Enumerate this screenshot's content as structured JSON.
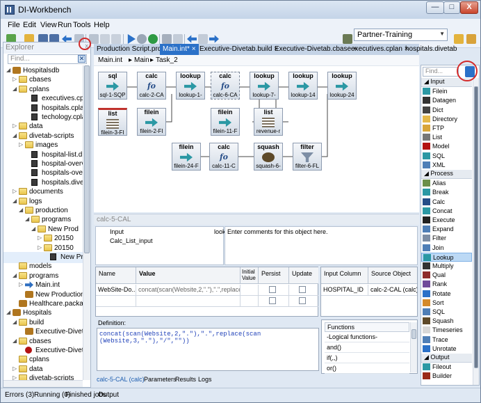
{
  "window": {
    "title": "DI-Workbench",
    "min": "—",
    "max": "□",
    "close": "X"
  },
  "menu": [
    "File",
    "Edit",
    "View",
    "Run",
    "Tools",
    "Help"
  ],
  "toolbar": {
    "workspace": "Partner-Training"
  },
  "explorer": {
    "title": "Explorer",
    "find_placeholder": "Find...",
    "tree": [
      {
        "label": "Hospitalsdb",
        "indent": 0,
        "arrow": "◢",
        "icon": "db"
      },
      {
        "label": "cbases",
        "indent": 1,
        "arrow": "▷",
        "icon": "folder"
      },
      {
        "label": "cplans",
        "indent": 1,
        "arrow": "◢",
        "icon": "folder"
      },
      {
        "label": "executives.cplan",
        "indent": 3,
        "arrow": "",
        "icon": "file"
      },
      {
        "label": "hospitals.cplan",
        "indent": 3,
        "arrow": "",
        "icon": "file"
      },
      {
        "label": "techology.cplan",
        "indent": 3,
        "arrow": "",
        "icon": "file"
      },
      {
        "label": "data",
        "indent": 1,
        "arrow": "▷",
        "icon": "folder"
      },
      {
        "label": "divetab-scripts",
        "indent": 1,
        "arrow": "◢",
        "icon": "folder"
      },
      {
        "label": "images",
        "indent": 2,
        "arrow": "▷",
        "icon": "folder"
      },
      {
        "label": "hospital-list.dive",
        "indent": 3,
        "arrow": "",
        "icon": "file"
      },
      {
        "label": "hospital-overvie",
        "indent": 3,
        "arrow": "",
        "icon": "file"
      },
      {
        "label": "hospitals-overvi",
        "indent": 3,
        "arrow": "",
        "icon": "file"
      },
      {
        "label": "hospitals.divetal",
        "indent": 3,
        "arrow": "",
        "icon": "file"
      },
      {
        "label": "documents",
        "indent": 1,
        "arrow": "▷",
        "icon": "folder"
      },
      {
        "label": "logs",
        "indent": 1,
        "arrow": "◢",
        "icon": "folder"
      },
      {
        "label": "production",
        "indent": 2,
        "arrow": "◢",
        "icon": "folder"
      },
      {
        "label": "programs",
        "indent": 3,
        "arrow": "◢",
        "icon": "folder"
      },
      {
        "label": "New Prod",
        "indent": 4,
        "arrow": "◢",
        "icon": "folder"
      },
      {
        "label": "20150",
        "indent": 5,
        "arrow": "▷",
        "icon": "folder"
      },
      {
        "label": "20150",
        "indent": 5,
        "arrow": "▷",
        "icon": "folder"
      },
      {
        "label": "New Pr",
        "indent": 6,
        "arrow": "",
        "icon": "file",
        "highlight": true
      },
      {
        "label": "models",
        "indent": 1,
        "arrow": "",
        "icon": "folder"
      },
      {
        "label": "programs",
        "indent": 1,
        "arrow": "◢",
        "icon": "folder"
      },
      {
        "label": "Main.int",
        "indent": 2,
        "arrow": "▷",
        "icon": "arrowfile"
      },
      {
        "label": "New Production",
        "indent": 2,
        "arrow": "",
        "icon": "gear"
      },
      {
        "label": "Healthcare.package",
        "indent": 1,
        "arrow": "",
        "icon": "db"
      },
      {
        "label": "Hospitals",
        "indent": 0,
        "arrow": "◢",
        "icon": "db"
      },
      {
        "label": "build",
        "indent": 1,
        "arrow": "◢",
        "icon": "folder"
      },
      {
        "label": "Executive-Diveta",
        "indent": 2,
        "arrow": "",
        "icon": "gear"
      },
      {
        "label": "cbases",
        "indent": 1,
        "arrow": "◢",
        "icon": "folder"
      },
      {
        "label": "Executive-Divetal",
        "indent": 2,
        "arrow": "",
        "icon": "redball"
      },
      {
        "label": "cplans",
        "indent": 1,
        "arrow": "",
        "icon": "folder"
      },
      {
        "label": "data",
        "indent": 1,
        "arrow": "▷",
        "icon": "folder"
      },
      {
        "label": "divetab-scripts",
        "indent": 1,
        "arrow": "▷",
        "icon": "folder"
      },
      {
        "label": "documents",
        "indent": 1,
        "arrow": "▷",
        "icon": "folder"
      }
    ]
  },
  "tabs": [
    {
      "label": "Production Script.prd",
      "close": "×",
      "active": false
    },
    {
      "label": "Main.int*",
      "close": "×",
      "active": true
    },
    {
      "label": "Executive-Divetab.build",
      "close": "×",
      "active": false
    },
    {
      "label": "Executive-Divetab.cbase",
      "close": "×",
      "active": false
    },
    {
      "label": "executives.cplan",
      "close": "×",
      "active": false
    },
    {
      "label": "hospitals.divetab",
      "close": "×",
      "active": false
    }
  ],
  "breadcrumb": {
    "a": "Main.int",
    "sep1": "▸",
    "b": "Main",
    "sep2": "▸",
    "c": "Task_2"
  },
  "nodes": [
    {
      "type": "sql",
      "name": "sql-1-SQP",
      "glyph": "arrow"
    },
    {
      "type": "calc",
      "name": "calc-2-CA",
      "glyph": "fo"
    },
    {
      "type": "lookup",
      "name": "lookup-1-",
      "glyph": "arrow"
    },
    {
      "type": "calc",
      "name": "calc-6-CA",
      "glyph": "fo"
    },
    {
      "type": "lookup",
      "name": "lookup-7-",
      "glyph": "arrow"
    },
    {
      "type": "lookup",
      "name": "lookup-14",
      "glyph": "arrow"
    },
    {
      "type": "lookup",
      "name": "lookup-24",
      "glyph": "arrow"
    },
    {
      "type": "list",
      "name": "filein-3-FI",
      "glyph": "list"
    },
    {
      "type": "filein",
      "name": "filein-2-FI",
      "glyph": "arrow"
    },
    {
      "type": "filein",
      "name": "filein-11-F",
      "glyph": "arrow"
    },
    {
      "type": "list",
      "name": "revenue-r",
      "glyph": "list"
    },
    {
      "type": "filein",
      "name": "filein-24-F",
      "glyph": "arrow"
    },
    {
      "type": "calc",
      "name": "calc-11-C",
      "glyph": "fo"
    },
    {
      "type": "squash",
      "name": "squash-6-",
      "glyph": "squash"
    },
    {
      "type": "filter",
      "name": "filter-6-FL",
      "glyph": "filter"
    }
  ],
  "fo_glyph": "fo",
  "panel": {
    "title": "calc-5-CAL",
    "pin": "ᛝ",
    "props": [
      {
        "k": "Input",
        "v": "look"
      },
      {
        "k": "Calc_List_input",
        "v": ""
      }
    ],
    "comment": "Enter comments for this object here."
  },
  "grid": {
    "headers": [
      "Name",
      "Value",
      "Initial Value",
      "Persist",
      "Update"
    ],
    "row": {
      "name": "WebSite-Do...",
      "value": "concat(scan(Website,2,\".\"),\".\",replace(s..."
    }
  },
  "io": {
    "headers": [
      "Input Column",
      "Source Object"
    ],
    "row": [
      "HOSPITAL_ID",
      "calc-2-CAL (calc)"
    ]
  },
  "definition": {
    "label": "Definition:",
    "line1": "concat(scan(Website,2,\".\"),\".\",replace(scan",
    "line2": "(Website,3,\".\"),\"/\",\"\"))"
  },
  "functions": {
    "title": "Functions",
    "items": [
      "-Logical functions-",
      "and()",
      "if(,,)",
      "or()"
    ]
  },
  "bottom_tabs": [
    "calc-5-CAL (calc)",
    "Parameters",
    "Results",
    "Logs"
  ],
  "toolbox": {
    "find_placeholder": "Find...",
    "sections": [
      {
        "title": "◢ Input",
        "items": [
          {
            "label": "Filein",
            "icon": "#2b98a4"
          },
          {
            "label": "Datagen",
            "icon": "#333333"
          },
          {
            "label": "Dict",
            "icon": "#444444"
          },
          {
            "label": "Directory",
            "icon": "#e4b84a"
          },
          {
            "label": "FTP",
            "icon": "#d8a53a"
          },
          {
            "label": "List",
            "icon": "#777777"
          },
          {
            "label": "Model",
            "icon": "#b31212"
          },
          {
            "label": "SQL",
            "icon": "#2b98a4"
          },
          {
            "label": "XML",
            "icon": "#4f7fb7"
          }
        ]
      },
      {
        "title": "◢ Process",
        "items": [
          {
            "label": "Alias",
            "icon": "#6b8f4a"
          },
          {
            "label": "Break",
            "icon": "#2b98a4"
          },
          {
            "label": "Calc",
            "icon": "#264d88"
          },
          {
            "label": "Concat",
            "icon": "#2b98a4"
          },
          {
            "label": "Execute",
            "icon": "#222222"
          },
          {
            "label": "Expand",
            "icon": "#4f7fb7"
          },
          {
            "label": "Filter",
            "icon": "#7d8ea5"
          },
          {
            "label": "Join",
            "icon": "#4f7fb7"
          },
          {
            "label": "Lookup",
            "icon": "#2b98a4",
            "selected": true
          },
          {
            "label": "Multiply",
            "icon": "#333333"
          },
          {
            "label": "Qual",
            "icon": "#8e2c2c"
          },
          {
            "label": "Rank",
            "icon": "#6f4a9a"
          },
          {
            "label": "Rotate",
            "icon": "#2b71c8"
          },
          {
            "label": "Sort",
            "icon": "#d48a2a"
          },
          {
            "label": "SQL",
            "icon": "#4f7fb7"
          },
          {
            "label": "Squash",
            "icon": "#5e4a2a"
          },
          {
            "label": "Timeseries",
            "icon": "#d8d8d8"
          },
          {
            "label": "Trace",
            "icon": "#4f7fb7"
          },
          {
            "label": "Unrotate",
            "icon": "#2b71c8"
          }
        ]
      },
      {
        "title": "◢ Output",
        "items": [
          {
            "label": "Fileout",
            "icon": "#2b98a4"
          },
          {
            "label": "Builder",
            "icon": "#9a2a18"
          }
        ]
      }
    ]
  },
  "status": {
    "errors": "Errors (3)",
    "running": "Running (0)",
    "finished": "Finished jobs",
    "output": "Output"
  }
}
